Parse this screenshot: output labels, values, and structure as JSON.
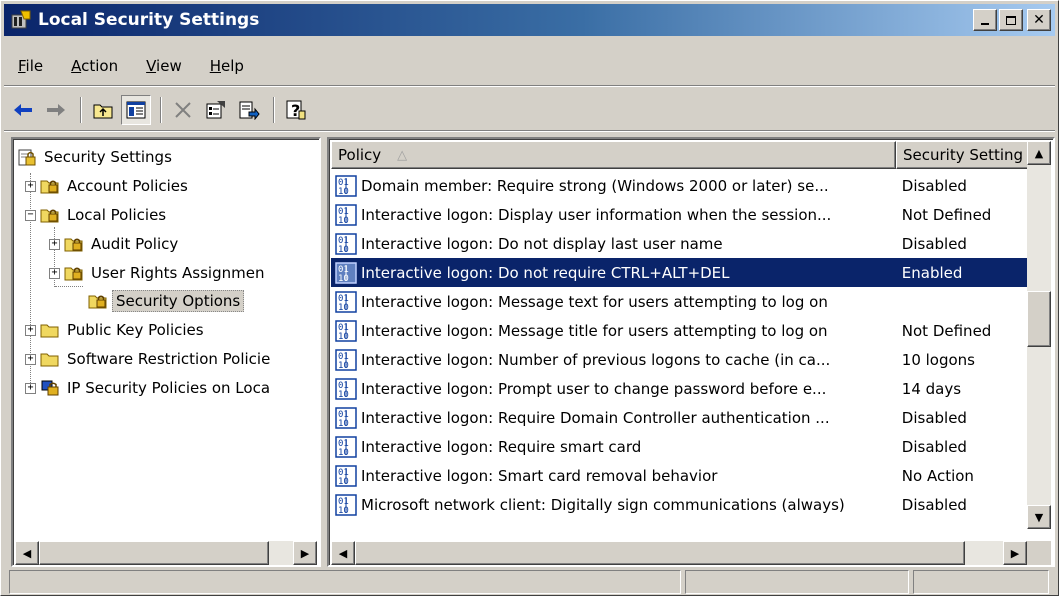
{
  "window": {
    "title": "Local Security Settings"
  },
  "menu": [
    {
      "label": "File",
      "u": "F",
      "rest": "ile"
    },
    {
      "label": "Action",
      "u": "A",
      "rest": "ction"
    },
    {
      "label": "View",
      "u": "V",
      "rest": "iew"
    },
    {
      "label": "Help",
      "u": "H",
      "rest": "elp"
    }
  ],
  "toolbar": [
    "back-arrow-icon",
    "forward-arrow-icon",
    "up-folder-icon",
    "show-hide-tree-icon",
    "delete-icon",
    "properties-icon",
    "export-list-icon",
    "help-icon"
  ],
  "tree": {
    "root": "Security Settings",
    "items": [
      {
        "label": "Account Policies"
      },
      {
        "label": "Local Policies"
      },
      {
        "label": "Audit Policy"
      },
      {
        "label": "User Rights Assignmen"
      },
      {
        "label": "Security Options"
      },
      {
        "label": "Public Key Policies"
      },
      {
        "label": "Software Restriction Policie"
      },
      {
        "label": "IP Security Policies on Loca"
      }
    ]
  },
  "list": {
    "columns": [
      "Policy",
      "Security Setting"
    ],
    "sort_indicator": "△",
    "rows": [
      {
        "policy": "Domain member: Require strong (Windows 2000 or later) se...",
        "setting": "Disabled"
      },
      {
        "policy": "Interactive logon: Display user information when the session...",
        "setting": "Not Defined"
      },
      {
        "policy": "Interactive logon: Do not display last user name",
        "setting": "Disabled"
      },
      {
        "policy": "Interactive logon: Do not require CTRL+ALT+DEL",
        "setting": "Enabled"
      },
      {
        "policy": "Interactive logon: Message text for users attempting to log on",
        "setting": ""
      },
      {
        "policy": "Interactive logon: Message title for users attempting to log on",
        "setting": "Not Defined"
      },
      {
        "policy": "Interactive logon: Number of previous logons to cache (in ca...",
        "setting": "10 logons"
      },
      {
        "policy": "Interactive logon: Prompt user to change password before e...",
        "setting": "14 days"
      },
      {
        "policy": "Interactive logon: Require Domain Controller authentication ...",
        "setting": "Disabled"
      },
      {
        "policy": "Interactive logon: Require smart card",
        "setting": "Disabled"
      },
      {
        "policy": "Interactive logon: Smart card removal behavior",
        "setting": "No Action"
      },
      {
        "policy": "Microsoft network client: Digitally sign communications (always)",
        "setting": "Disabled"
      }
    ]
  },
  "colors": {
    "titlebar": "#0a246a",
    "selection": "#0a246a",
    "face": "#d4d0c8"
  }
}
